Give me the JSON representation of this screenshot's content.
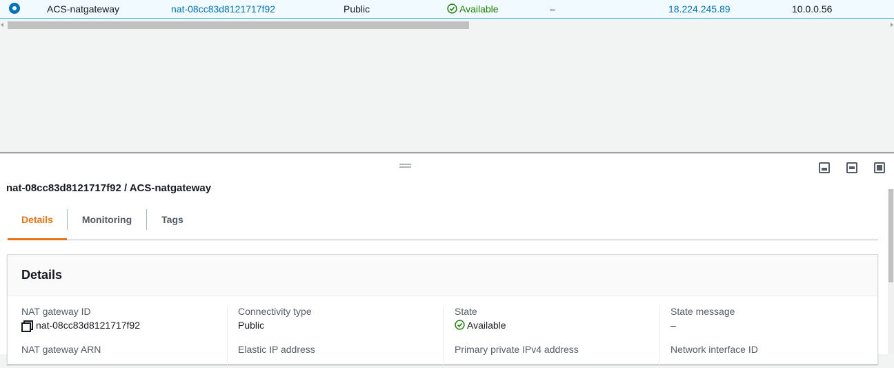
{
  "table_row": {
    "selected": true,
    "name": "ACS-natgateway",
    "nat_gateway_id": "nat-08cc83d8121717f92",
    "connectivity_type": "Public",
    "state": "Available",
    "state_message": "–",
    "elastic_ip": "18.224.245.89",
    "private_ip": "10.0.0.56"
  },
  "split_panel": {
    "title": "nat-08cc83d8121717f92 / ACS-natgateway",
    "tabs": [
      {
        "label": "Details",
        "active": true
      },
      {
        "label": "Monitoring",
        "active": false
      },
      {
        "label": "Tags",
        "active": false
      }
    ],
    "details": {
      "heading": "Details",
      "columns": [
        {
          "label": "NAT gateway ID",
          "value": "nat-08cc83d8121717f92",
          "icon": "copy-icon",
          "next_label": "NAT gateway ARN"
        },
        {
          "label": "Connectivity type",
          "value": "Public",
          "next_label": "Elastic IP address"
        },
        {
          "label": "State",
          "value": "Available",
          "icon": "check-circle-icon",
          "next_label": "Primary private IPv4 address"
        },
        {
          "label": "State message",
          "value": "–",
          "next_label": "Network interface ID"
        }
      ]
    }
  },
  "colors": {
    "link": "#0073bb",
    "success": "#1d8102",
    "active_tab": "#ec7211",
    "selected_row_bg": "#f1faff"
  }
}
